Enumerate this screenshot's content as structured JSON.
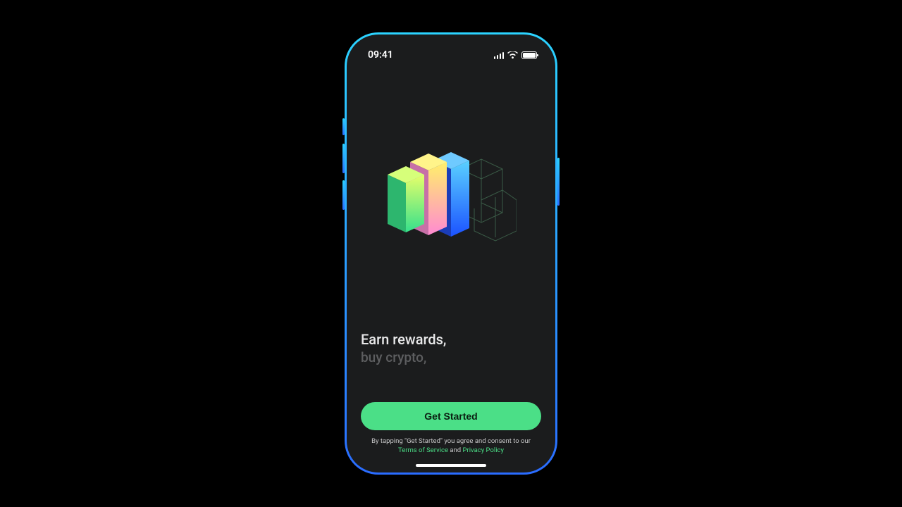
{
  "statusbar": {
    "time": "09:41"
  },
  "tagline": {
    "line1": "Earn rewards,",
    "line2": "buy crypto,"
  },
  "cta": {
    "label": "Get Started"
  },
  "legal": {
    "prefix": "By tapping \"Get Started\" you agree and consent to our",
    "terms": "Terms of Service",
    "and": " and ",
    "privacy": "Privacy Policy"
  }
}
